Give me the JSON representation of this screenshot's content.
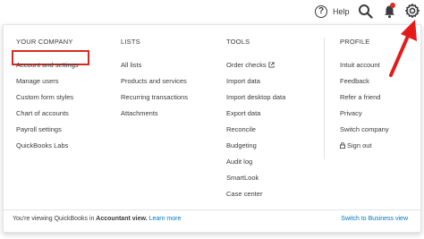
{
  "topbar": {
    "help_glyph": "?",
    "help_label": "Help",
    "icons": [
      "help-icon",
      "search-icon",
      "bell-icon",
      "gear-icon"
    ]
  },
  "menu": {
    "columns": [
      {
        "heading": "YOUR COMPANY",
        "items": [
          "Account and settings",
          "Manage users",
          "Custom form styles",
          "Chart of accounts",
          "Payroll settings",
          "QuickBooks Labs"
        ]
      },
      {
        "heading": "LISTS",
        "items": [
          "All lists",
          "Products and services",
          "Recurring transactions",
          "Attachments"
        ]
      },
      {
        "heading": "TOOLS",
        "items": [
          "Order checks",
          "Import data",
          "Import desktop data",
          "Export data",
          "Reconcile",
          "Budgeting",
          "Audit log",
          "SmartLook",
          "Case center"
        ]
      },
      {
        "heading": "PROFILE",
        "items": [
          "Intuit account",
          "Feedback",
          "Refer a friend",
          "Privacy",
          "Switch company",
          "Sign out"
        ]
      }
    ],
    "highlighted_item": "Account and settings"
  },
  "footer": {
    "prefix": "You're viewing QuickBooks in ",
    "view_name": "Accountant view.",
    "learn_more": "Learn more",
    "switch_link": "Switch to Business view"
  },
  "colors": {
    "link": "#0077c5",
    "highlight": "#d52b1e",
    "arrow": "#e31b1b",
    "notification_dot": "#e02b27",
    "text": "#393a3d"
  }
}
